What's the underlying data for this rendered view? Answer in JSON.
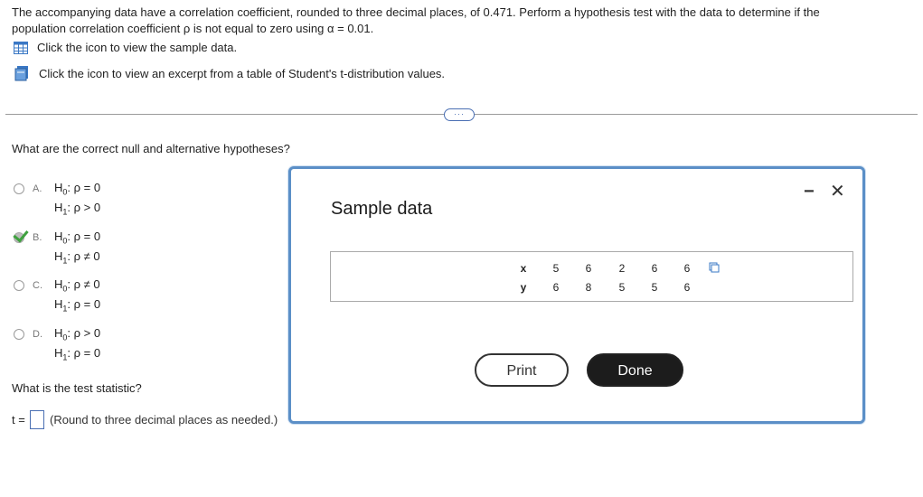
{
  "intro": {
    "line1": "The accompanying data have a correlation coefficient, rounded to three decimal places, of 0.471. Perform a hypothesis test with the data to determine if the",
    "line2": "population correlation coefficient ρ is not equal to zero using α = 0.01.",
    "data_link": "Click the icon to view the sample data.",
    "table_link": "Click the icon to view an excerpt from a table of Student's t-distribution values."
  },
  "more_button": "···",
  "question1": "What are the correct null and alternative hypotheses?",
  "choices": [
    {
      "letter": "A.",
      "h0": "ρ = 0",
      "h1": "ρ > 0"
    },
    {
      "letter": "B.",
      "h0": "ρ = 0",
      "h1": "ρ ≠ 0"
    },
    {
      "letter": "C.",
      "h0": "ρ ≠ 0",
      "h1": "ρ = 0"
    },
    {
      "letter": "D.",
      "h0": "ρ > 0",
      "h1": "ρ = 0"
    }
  ],
  "selected_choice": "B.",
  "hyp_labels": {
    "h0_prefix": "H",
    "h0_sub": "0",
    "h1_prefix": "H",
    "h1_sub": "1",
    "sep": ":"
  },
  "question2": "What is the test statistic?",
  "answer": {
    "prefix": "t =",
    "value": "",
    "hint": "(Round to three decimal places as needed.)"
  },
  "modal": {
    "title": "Sample data",
    "minimize": "−",
    "close": "✕",
    "table": {
      "x_label": "x",
      "y_label": "y",
      "x": [
        "5",
        "6",
        "2",
        "6",
        "6"
      ],
      "y": [
        "6",
        "8",
        "5",
        "5",
        "6"
      ]
    },
    "print_label": "Print",
    "done_label": "Done"
  }
}
